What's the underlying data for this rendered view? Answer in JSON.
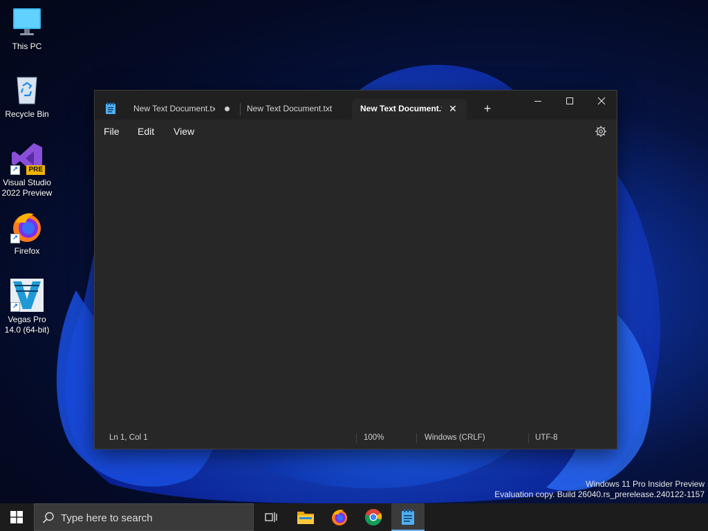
{
  "desktop": {
    "icons": [
      {
        "label": "This PC",
        "icon": "monitor-icon"
      },
      {
        "label": "Recycle Bin",
        "icon": "recycle-bin-icon"
      },
      {
        "label": "Visual Studio 2022 Preview",
        "icon": "visual-studio-icon",
        "badge": "PRE"
      },
      {
        "label": "Firefox",
        "icon": "firefox-icon"
      },
      {
        "label": "Vegas Pro 14.0 (64-bit)",
        "icon": "vegas-pro-icon"
      }
    ]
  },
  "window": {
    "app": "Notepad",
    "tabs": [
      {
        "label": "New Text Document.txt",
        "state": "unsaved"
      },
      {
        "label": "New Text Document.txt",
        "state": "saved"
      },
      {
        "label": "New Text Document.txt",
        "state": "active"
      }
    ],
    "new_tab_symbol": "+",
    "controls": {
      "minimize": "minimize-icon",
      "maximize": "maximize-icon",
      "close": "close-icon"
    },
    "menu": [
      "File",
      "Edit",
      "View"
    ],
    "editor_text": "",
    "status": {
      "position": "Ln 1, Col 1",
      "zoom": "100%",
      "line_ending": "Windows (CRLF)",
      "encoding": "UTF-8"
    }
  },
  "watermark": {
    "line1": "Windows 11 Pro Insider Preview",
    "line2": "Evaluation copy. Build 26040.rs_prerelease.240122-1157"
  },
  "taskbar": {
    "search_placeholder": "Type here to search",
    "apps": [
      {
        "name": "task-view",
        "active": false
      },
      {
        "name": "file-explorer",
        "active": false
      },
      {
        "name": "firefox",
        "active": false
      },
      {
        "name": "chrome",
        "active": false
      },
      {
        "name": "notepad",
        "active": true
      }
    ]
  },
  "colors": {
    "accent": "#6ab0f3",
    "window_bg": "#272727",
    "titlebar_bg": "#202020",
    "taskbar_bg": "#1c1c1c"
  }
}
